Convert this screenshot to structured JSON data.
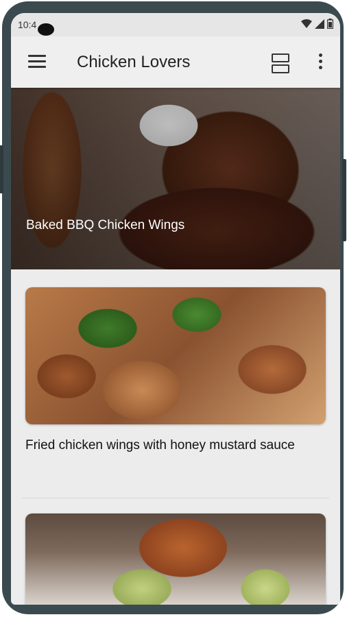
{
  "status_bar": {
    "time": "10:4"
  },
  "app_bar": {
    "title": "Chicken Lovers"
  },
  "icons": {
    "menu": "menu-icon",
    "layout": "view-agenda-icon",
    "more": "more-vert-icon",
    "wifi": "wifi-icon",
    "signal": "signal-icon",
    "battery": "battery-icon"
  },
  "recipes": [
    {
      "title": "Baked BBQ Chicken Wings"
    },
    {
      "title": "Fried chicken wings with honey mustard sauce"
    },
    {
      "title": ""
    }
  ],
  "colors": {
    "frame": "#3b4a4f",
    "app_bar": "#efefef",
    "background": "#ececec",
    "text": "#222222"
  }
}
